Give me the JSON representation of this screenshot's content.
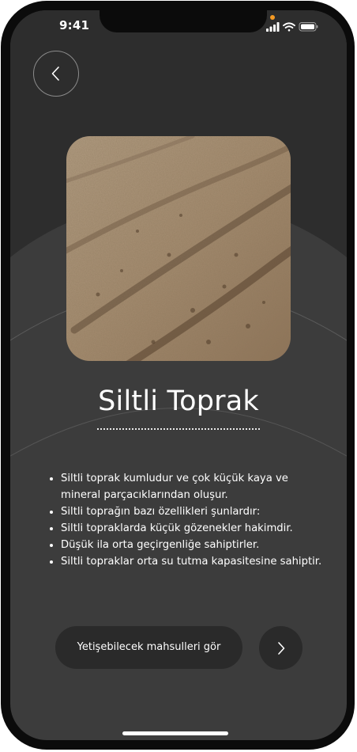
{
  "status_bar": {
    "time": "9:41",
    "icons": [
      "cellular-signal-icon",
      "wifi-icon",
      "battery-icon"
    ]
  },
  "header": {
    "back_icon": "chevron-left-icon"
  },
  "soil": {
    "image": "plowed-silt-soil-photo",
    "title": "Siltli Toprak",
    "description": [
      "Siltli toprak kumludur ve çok küçük kaya ve mineral parçacıklarından oluşur.",
      "Siltli toprağın bazı özellikleri şunlardır:",
      "Siltli topraklarda küçük gözenekler hakimdir.",
      "Düşük ila orta geçirgenliğe sahiptirler.",
      "Siltli topraklar orta su tutma kapasitesine sahiptir."
    ]
  },
  "actions": {
    "crops_button_label": "Yetişebilecek mahsulleri gör",
    "next_icon": "chevron-right-icon"
  },
  "colors": {
    "background": "#3c3c3c",
    "top_area": "#2d2d2d",
    "button": "#2a2a2a",
    "notification_dot": "#f59a23"
  }
}
